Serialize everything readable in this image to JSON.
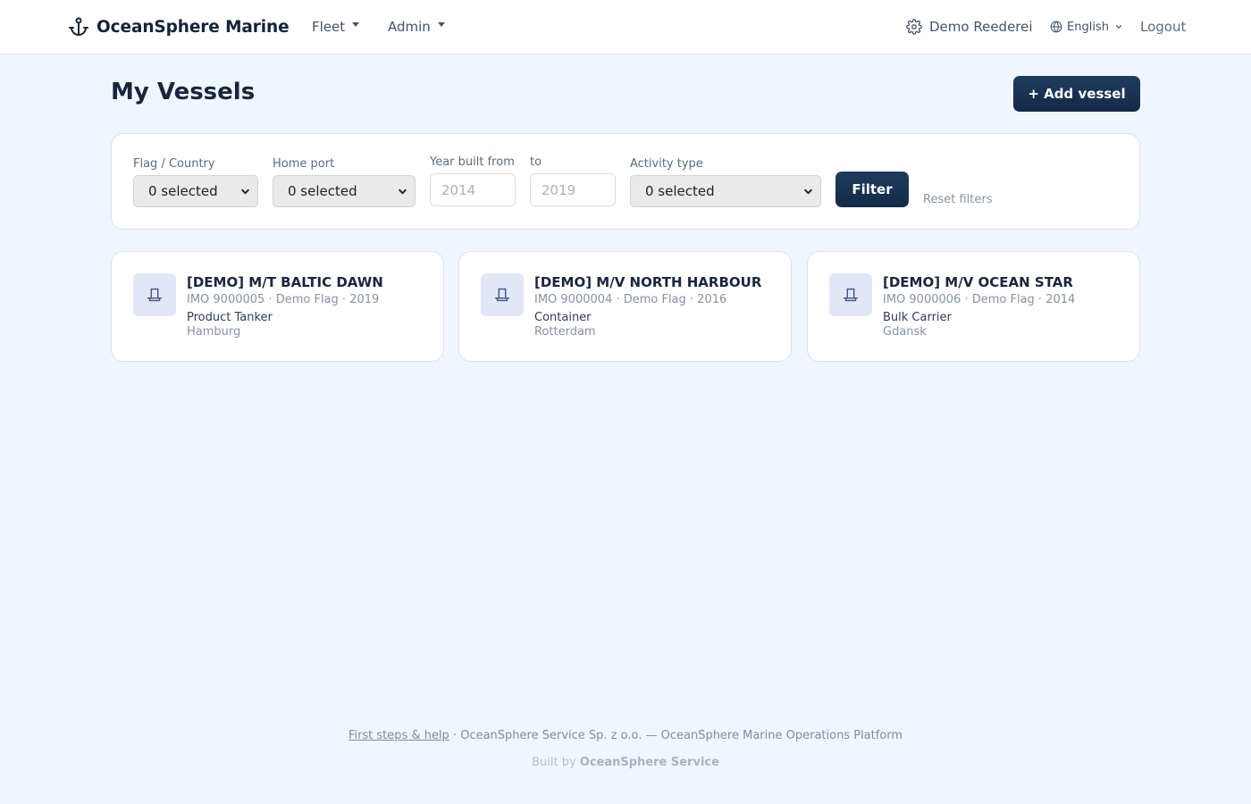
{
  "navbar": {
    "brand": "OceanSphere Marine",
    "brand_icon": "anchor-icon",
    "menus": [
      "Fleet",
      "Admin"
    ],
    "org_name": "Demo Reederei",
    "language": "English",
    "logout": "Logout"
  },
  "header": {
    "title": "My Vessels",
    "add_button": "+ Add vessel"
  },
  "filters": {
    "flag": {
      "label": "Flag / Country",
      "value": "0 selected"
    },
    "home_port": {
      "label": "Home port",
      "value": "0 selected"
    },
    "year_from": {
      "label": "Year built from",
      "placeholder": "2014"
    },
    "year_to": {
      "label": "to",
      "placeholder": "2019"
    },
    "activity": {
      "label": "Activity type",
      "value": "0 selected"
    },
    "filter_button": "Filter",
    "reset": "Reset filters"
  },
  "vessels": [
    {
      "name": "[DEMO] M/T BALTIC DAWN",
      "meta": "IMO 9000005 · Demo Flag · 2019",
      "type": "Product Tanker",
      "port": "Hamburg"
    },
    {
      "name": "[DEMO] M/V NORTH HARBOUR",
      "meta": "IMO 9000004 · Demo Flag · 2016",
      "type": "Container",
      "port": "Rotterdam"
    },
    {
      "name": "[DEMO] M/V OCEAN STAR",
      "meta": "IMO 9000006 · Demo Flag · 2014",
      "type": "Bulk Carrier",
      "port": "Gdansk"
    }
  ],
  "footer": {
    "help_link": "First steps & help",
    "company": " · OceanSphere Service Sp. z o.o. — OceanSphere Marine Operations Platform",
    "built_by_prefix": "Built by ",
    "built_by_name": "OceanSphere Service"
  },
  "colors": {
    "background": "#eff6fd",
    "primary": "#1a3350",
    "card_icon_bg": "#e1e7f8"
  }
}
